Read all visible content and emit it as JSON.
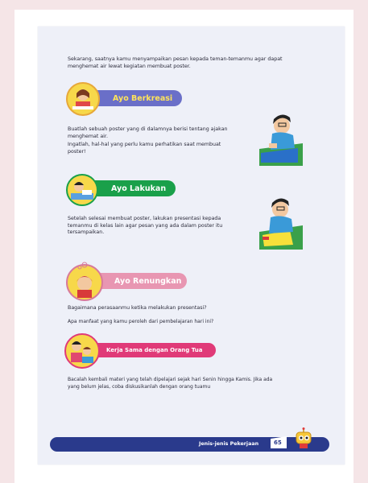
{
  "intro": {
    "line1": "Sekarang, saatnya kamu menyampaikan pesan kepada teman-temanmu agar dapat",
    "line2": "menghemat air lewat kegiatan membuat poster."
  },
  "section_berkreasi": {
    "title": "Ayo Berkreasi",
    "para1_line1": "Buatlah sebuah poster yang di dalamnya berisi tentang ajakan",
    "para1_line2": "menghemat air.",
    "para2_line1": "Ingatlah, hal-hal yang perlu kamu perhatikan saat membuat",
    "para2_line2": "poster!"
  },
  "section_lakukan": {
    "title": "Ayo Lakukan",
    "line1": "Setelah selesai membuat poster, lakukan presentasi kepada",
    "line2": "temanmu di kelas lain agar pesan yang ada dalam poster itu",
    "line3": "tersampaikan."
  },
  "section_renungkan": {
    "title": "Ayo Renungkan",
    "q1": "Bagaimana perasaanmu ketika melakukan presentasi?",
    "q2": "Apa manfaat yang kamu peroleh dari pembelajaran hari ini?"
  },
  "section_kerjasama": {
    "title": "Kerja Sama dengan Orang Tua",
    "line1": "Bacalah kembali materi yang telah dipelajari sejak hari Senin hingga Kamis. Jika ada",
    "line2": "yang belum jelas, coba diskusikanlah dengan orang tuamu"
  },
  "footer": {
    "chapter": "Jenis-jenis Pekerjaan",
    "page_number": "65"
  },
  "colors": {
    "berkreasi": "#6a6fc8",
    "lakukan": "#1aa04a",
    "renungkan": "#d87a9a",
    "kerjasama": "#e03a78",
    "footer": "#2a3a8c"
  }
}
